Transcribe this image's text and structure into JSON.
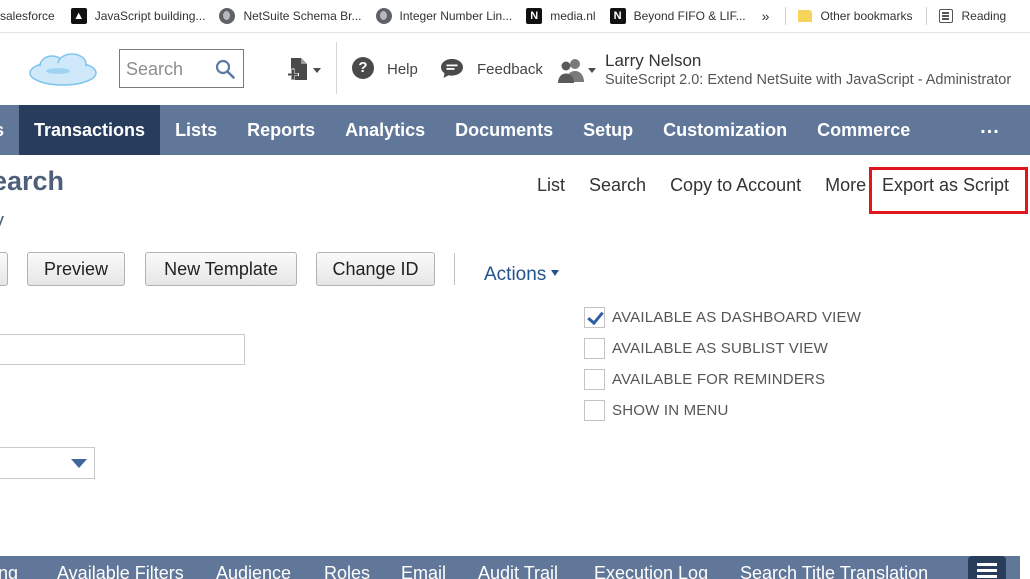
{
  "bookmarks": [
    {
      "label": "salesforce",
      "icon": "none"
    },
    {
      "label": "JavaScript building...",
      "icon": "app-icon"
    },
    {
      "label": "NetSuite Schema Br...",
      "icon": "globe-icon"
    },
    {
      "label": "Integer Number Lin...",
      "icon": "globe-icon"
    },
    {
      "label": "media.nl",
      "icon": "netsuite-icon"
    },
    {
      "label": "Beyond FIFO & LIF...",
      "icon": "netsuite-icon"
    }
  ],
  "bookmarks_more": "»",
  "other_bookmarks": "Other bookmarks",
  "reading_list": "Reading",
  "header": {
    "search_placeholder": "Search",
    "help_label": "Help",
    "feedback_label": "Feedback",
    "user_name": "Larry Nelson",
    "user_account": "SuiteScript 2.0: Extend NetSuite with JavaScript - Administrator"
  },
  "nav": {
    "partial_item": "s",
    "items": [
      "Transactions",
      "Lists",
      "Reports",
      "Analytics",
      "Documents",
      "Setup",
      "Customization",
      "Commerce"
    ],
    "active": "Transactions",
    "more": "..."
  },
  "page": {
    "title": "earch",
    "subline": "y",
    "links": [
      "List",
      "Search",
      "Copy to Account",
      "More"
    ],
    "export_link": "Export as Script"
  },
  "toolbar": {
    "preview": "Preview",
    "new_template": "New Template",
    "change_id": "Change ID",
    "actions": "Actions"
  },
  "checkboxes": [
    {
      "label": "AVAILABLE AS DASHBOARD VIEW",
      "checked": true
    },
    {
      "label": "AVAILABLE AS SUBLIST VIEW",
      "checked": false
    },
    {
      "label": "AVAILABLE FOR REMINDERS",
      "checked": false
    },
    {
      "label": "SHOW IN MENU",
      "checked": false
    }
  ],
  "subtabs": [
    "ing",
    "Available Filters",
    "Audience",
    "Roles",
    "Email",
    "Audit Trail",
    "Execution Log",
    "Search Title Translation"
  ],
  "colors": {
    "nav_bg": "#607799",
    "nav_active": "#283c5c",
    "title": "#4d5f79",
    "link_blue": "#24528e",
    "highlight": "#e0161c"
  }
}
